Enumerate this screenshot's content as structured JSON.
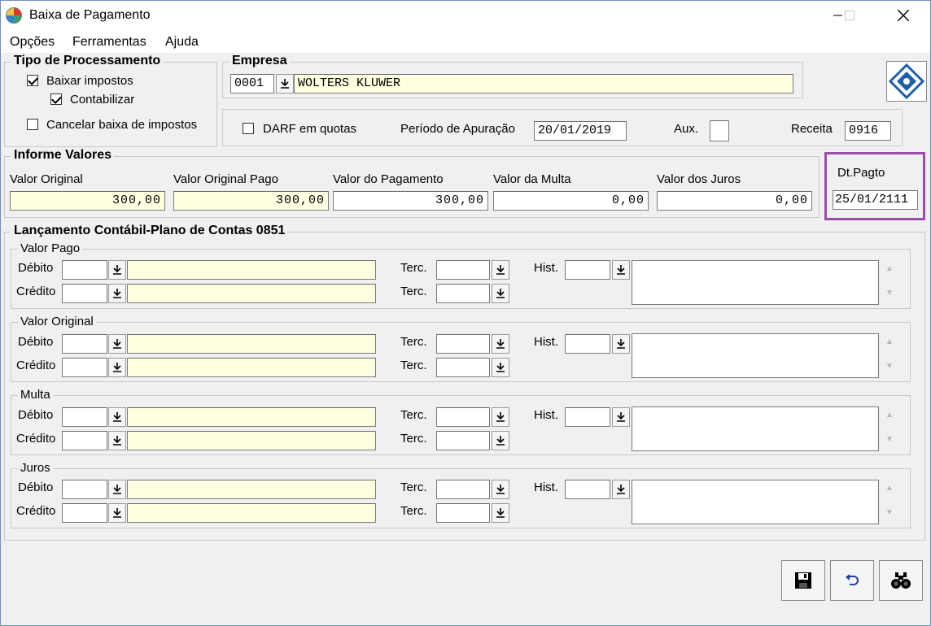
{
  "window": {
    "title": "Baixa de Pagamento"
  },
  "menu": [
    "Opções",
    "Ferramentas",
    "Ajuda"
  ],
  "tipo": {
    "title": "Tipo de Processamento",
    "baixar_impostos": {
      "label": "Baixar impostos",
      "checked": true
    },
    "contabilizar": {
      "label": "Contabilizar",
      "checked": true
    },
    "cancelar": {
      "label": "Cancelar baixa de impostos",
      "checked": false
    }
  },
  "empresa": {
    "title": "Empresa",
    "code": "0001",
    "name": "WOLTERS KLUWER"
  },
  "darf": {
    "quotas_label": "DARF em quotas",
    "quotas_checked": false,
    "periodo_label": "Período de Apuração",
    "periodo_value": "20/01/2019",
    "aux_label": "Aux.",
    "aux_value": "",
    "receita_label": "Receita",
    "receita_value": "0916"
  },
  "informe": {
    "title": "Informe Valores",
    "fields": [
      {
        "label": "Valor Original",
        "value": "300,00"
      },
      {
        "label": "Valor Original Pago",
        "value": "300,00"
      },
      {
        "label": "Valor do Pagamento",
        "value": "300,00"
      },
      {
        "label": "Valor da Multa",
        "value": "0,00"
      },
      {
        "label": "Valor dos Juros",
        "value": "0,00"
      }
    ]
  },
  "dtpagto": {
    "label": "Dt.Pagto",
    "value": "25/01/2111"
  },
  "lancamento": {
    "title": "Lançamento Contábil-Plano de Contas 0851",
    "debito_label": "Débito",
    "credito_label": "Crédito",
    "terc_label": "Terc.",
    "hist_label": "Hist.",
    "sections": [
      "Valor Pago",
      "Valor Original",
      "Multa",
      "Juros"
    ]
  },
  "toolbar": {
    "icons": [
      "save-icon",
      "undo-icon",
      "binoculars-icon"
    ]
  },
  "colors": {
    "highlight": "#9b4dac",
    "field_yellow": "#ffffe1"
  }
}
